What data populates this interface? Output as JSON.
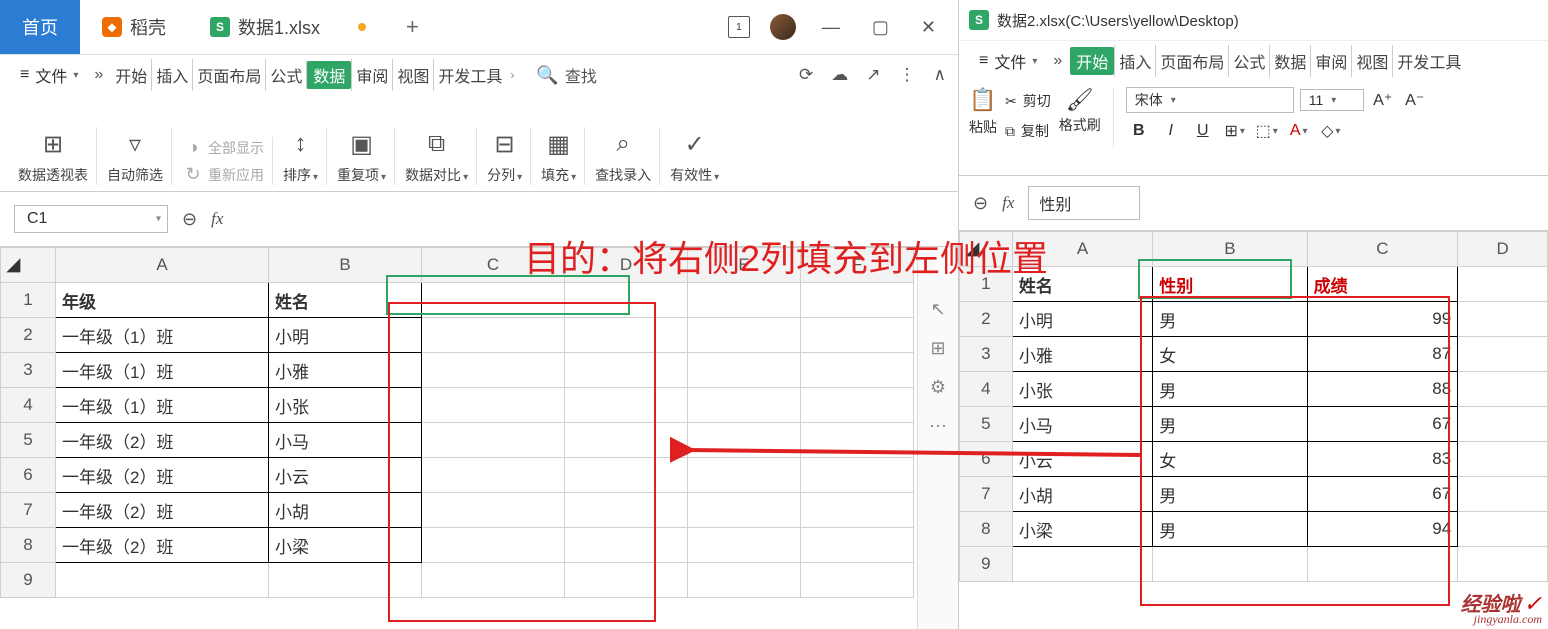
{
  "left": {
    "tabs": {
      "home": "首页",
      "shell": "稻壳",
      "doc": "数据1.xlsx"
    },
    "file_label": "文件",
    "menu": {
      "start": "开始",
      "insert": "插入",
      "layout": "页面布局",
      "formula": "公式",
      "data": "数据",
      "review": "审阅",
      "view": "视图",
      "dev": "开发工具"
    },
    "search": "查找",
    "ribbon": {
      "pivot": "数据透视表",
      "filter": "自动筛选",
      "showall": "全部显示",
      "reapply": "重新应用",
      "sort": "排序",
      "dup": "重复项",
      "compare": "数据对比",
      "split": "分列",
      "fill": "填充",
      "lookup": "查找录入",
      "valid": "有效性"
    },
    "cellref": "C1",
    "headers": [
      "A",
      "B",
      "C",
      "D",
      "E",
      "F"
    ],
    "rows": [
      {
        "n": 1,
        "a": "年级",
        "b": "姓名"
      },
      {
        "n": 2,
        "a": "一年级（1）班",
        "b": "小明"
      },
      {
        "n": 3,
        "a": "一年级（1）班",
        "b": "小雅"
      },
      {
        "n": 4,
        "a": "一年级（1）班",
        "b": "小张"
      },
      {
        "n": 5,
        "a": "一年级（2）班",
        "b": "小马"
      },
      {
        "n": 6,
        "a": "一年级（2）班",
        "b": "小云"
      },
      {
        "n": 7,
        "a": "一年级（2）班",
        "b": "小胡"
      },
      {
        "n": 8,
        "a": "一年级（2）班",
        "b": "小梁"
      },
      {
        "n": 9,
        "a": "",
        "b": ""
      }
    ]
  },
  "right": {
    "title": "数据2.xlsx(C:\\Users\\yellow\\Desktop)",
    "file_label": "文件",
    "menu": {
      "start": "开始",
      "insert": "插入",
      "layout": "页面布局",
      "formula": "公式",
      "data": "数据",
      "review": "审阅",
      "view": "视图",
      "dev": "开发工具"
    },
    "clip": {
      "paste": "粘贴",
      "cut": "剪切",
      "copy": "复制",
      "brush": "格式刷"
    },
    "font": {
      "name": "宋体",
      "size": "11"
    },
    "fx_value": "性别",
    "headers": [
      "A",
      "B",
      "C",
      "D"
    ],
    "rows": [
      {
        "n": 1,
        "a": "姓名",
        "b": "性别",
        "c": "成绩"
      },
      {
        "n": 2,
        "a": "小明",
        "b": "男",
        "c": "99"
      },
      {
        "n": 3,
        "a": "小雅",
        "b": "女",
        "c": "87"
      },
      {
        "n": 4,
        "a": "小张",
        "b": "男",
        "c": "88"
      },
      {
        "n": 5,
        "a": "小马",
        "b": "男",
        "c": "67"
      },
      {
        "n": 6,
        "a": "小云",
        "b": "女",
        "c": "83"
      },
      {
        "n": 7,
        "a": "小胡",
        "b": "男",
        "c": "67"
      },
      {
        "n": 8,
        "a": "小梁",
        "b": "男",
        "c": "94"
      },
      {
        "n": 9,
        "a": "",
        "b": "",
        "c": ""
      }
    ]
  },
  "annotation": "目的：将右侧2列填充到左侧位置",
  "watermark": {
    "big": "经验啦",
    "small": "jingyanla.com",
    "check": "✓"
  }
}
